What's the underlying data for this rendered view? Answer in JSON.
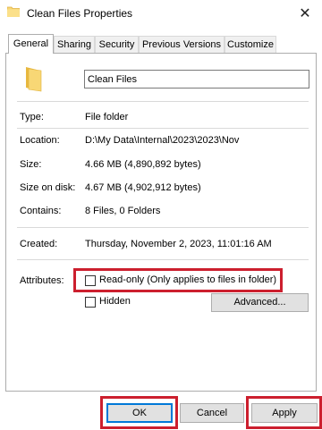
{
  "window": {
    "title": "Clean Files Properties",
    "close_glyph": "✕"
  },
  "tabs": [
    {
      "label": "General",
      "active": true
    },
    {
      "label": "Sharing",
      "active": false
    },
    {
      "label": "Security",
      "active": false
    },
    {
      "label": "Previous Versions",
      "active": false
    },
    {
      "label": "Customize",
      "active": false
    }
  ],
  "general": {
    "folder_name": "Clean Files",
    "type_label": "Type:",
    "type_value": "File folder",
    "location_label": "Location:",
    "location_value": "D:\\My Data\\Internal\\2023\\2023\\Nov",
    "size_label": "Size:",
    "size_value": "4.66 MB (4,890,892 bytes)",
    "size_on_disk_label": "Size on disk:",
    "size_on_disk_value": "4.67 MB (4,902,912 bytes)",
    "contains_label": "Contains:",
    "contains_value": "8 Files, 0 Folders",
    "created_label": "Created:",
    "created_value": "Thursday, November 2, 2023, 11:01:16 AM",
    "attributes_label": "Attributes:",
    "readonly_label": "Read-only (Only applies to files in folder)",
    "readonly_checked": false,
    "hidden_label": "Hidden",
    "hidden_checked": false,
    "advanced_label": "Advanced..."
  },
  "footer": {
    "ok_label": "OK",
    "cancel_label": "Cancel",
    "apply_label": "Apply"
  },
  "colors": {
    "folder": "#f8d775",
    "folder_dark": "#e8b83e",
    "highlight": "#cc1f2e",
    "accent": "#0078d7"
  }
}
